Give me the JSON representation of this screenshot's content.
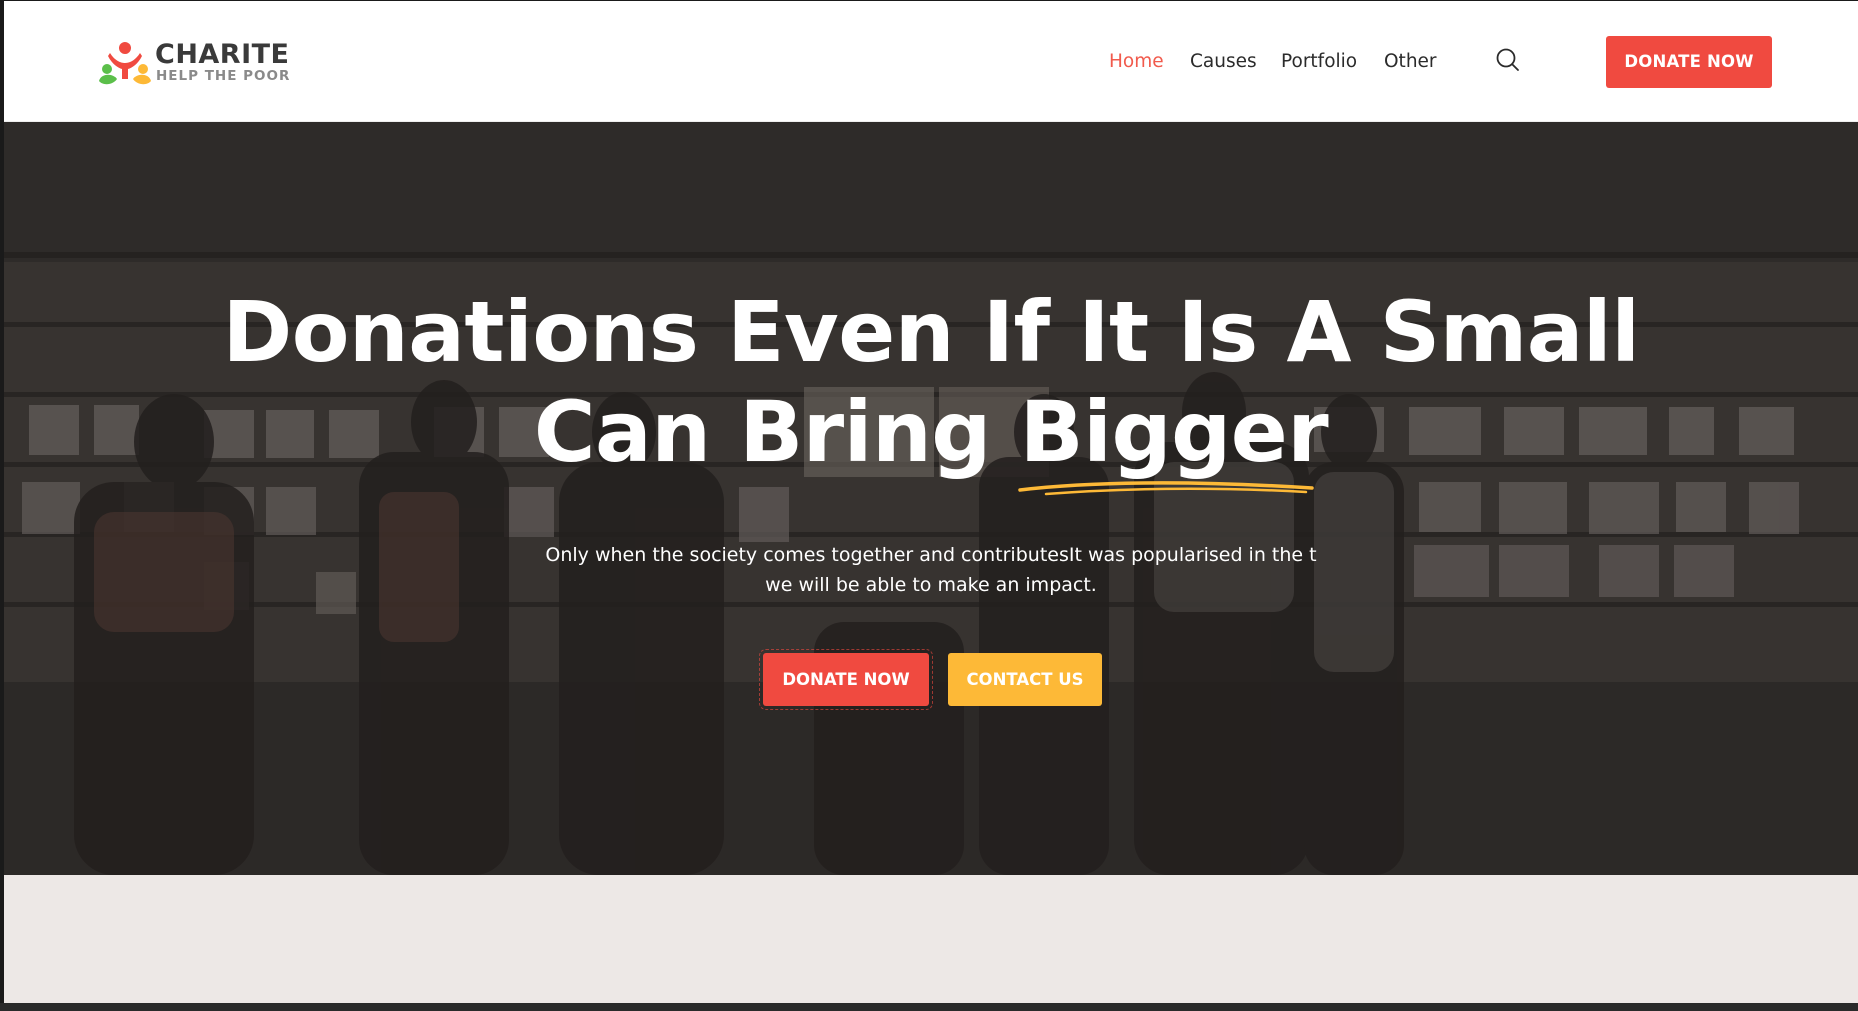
{
  "logo": {
    "name": "CHARITE",
    "tagline": "HELP THE POOR"
  },
  "nav": {
    "items": [
      {
        "label": "Home",
        "active": true
      },
      {
        "label": "Causes",
        "active": false
      },
      {
        "label": "Portfolio",
        "active": false
      },
      {
        "label": "Other",
        "active": false
      }
    ]
  },
  "header": {
    "donate_label": "DONATE NOW",
    "search_icon": "search-icon"
  },
  "hero": {
    "title_line1": "Donations Even If It Is A Small",
    "title_line2_prefix": "Can Bring ",
    "title_line2_accent": "Bigger",
    "subtitle_line1": "Only when the society comes together and contributesIt was popularised in the t",
    "subtitle_line2": "we will be able to make an impact.",
    "donate_label": "DONATE NOW",
    "contact_label": "CONTACT US"
  },
  "colors": {
    "primary": "#f04a40",
    "secondary": "#fdb937",
    "nav_active": "#f15a4c",
    "text_dark": "#2b2b2b",
    "underline": "#fdb937"
  }
}
